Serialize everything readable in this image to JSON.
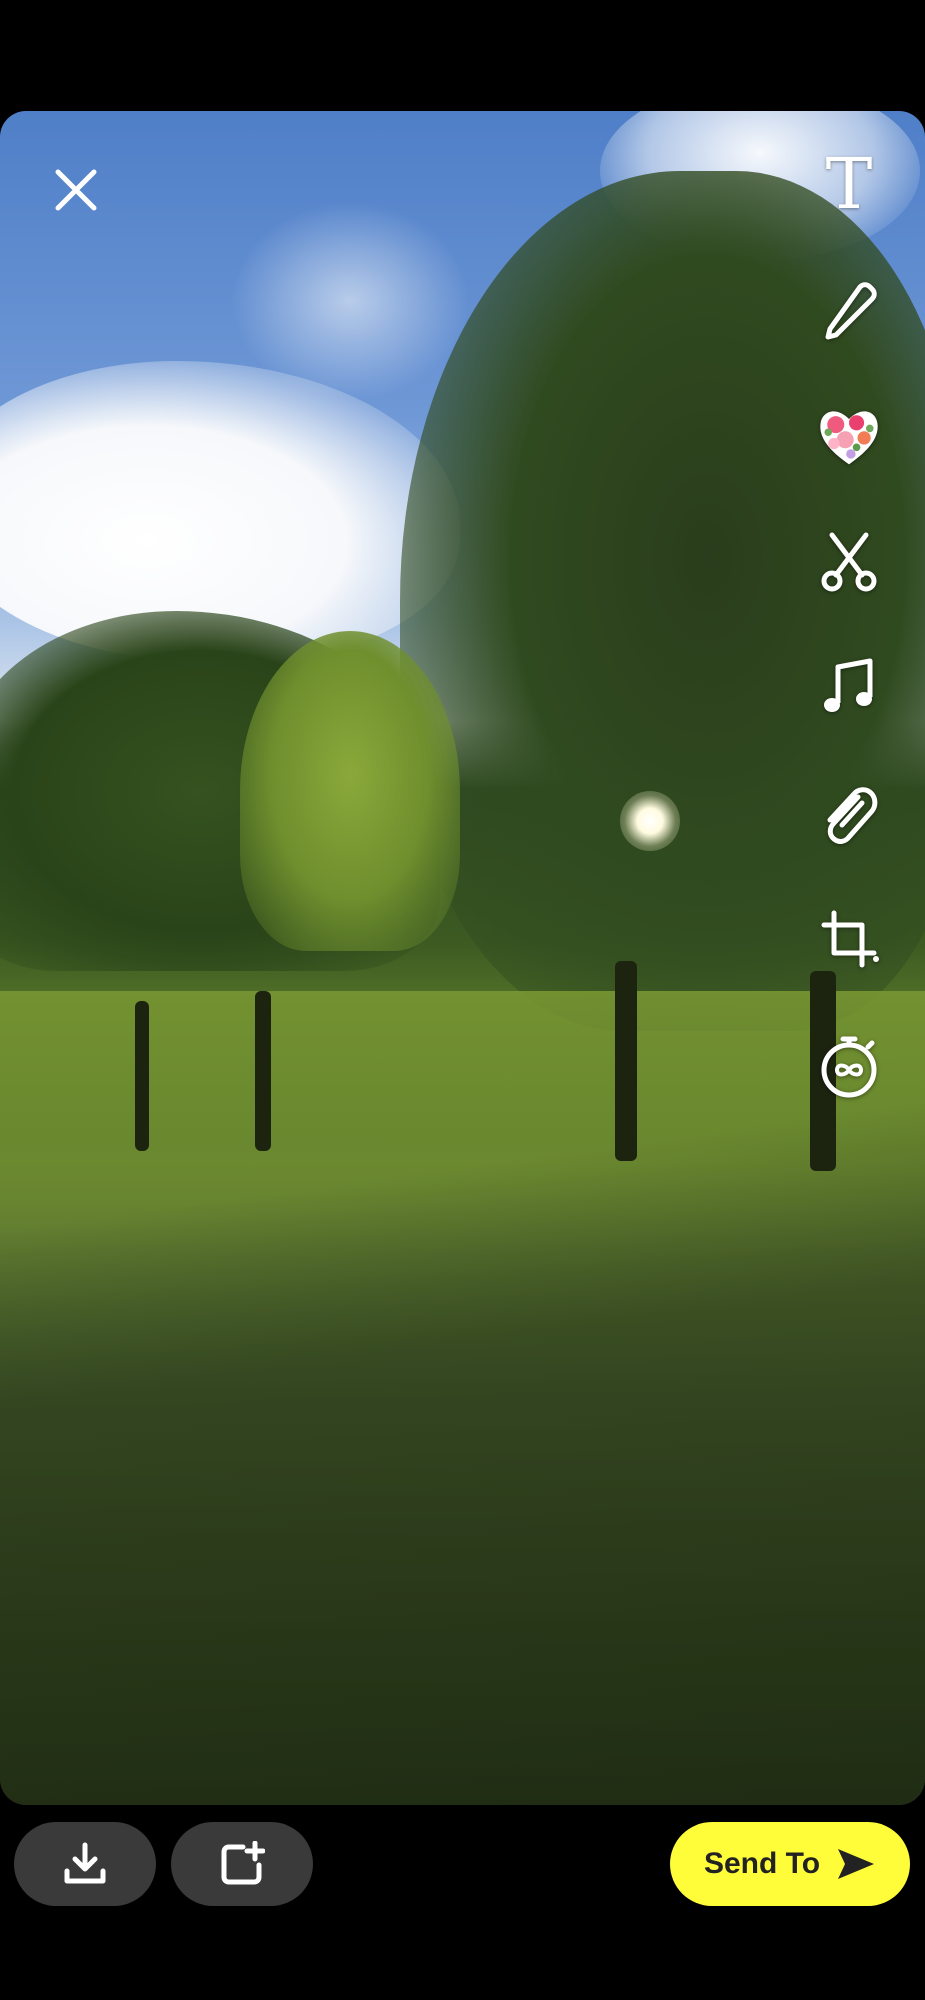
{
  "editor": {
    "close_icon": "close-x-icon",
    "tools": [
      {
        "name": "text-tool",
        "icon": "text-T-icon",
        "glyph": "T"
      },
      {
        "name": "draw-tool",
        "icon": "pencil-icon"
      },
      {
        "name": "sticker-tool",
        "icon": "flower-heart-sticker-icon"
      },
      {
        "name": "scissors-tool",
        "icon": "scissors-icon"
      },
      {
        "name": "music-tool",
        "icon": "music-note-icon"
      },
      {
        "name": "link-tool",
        "icon": "paperclip-icon"
      },
      {
        "name": "crop-tool",
        "icon": "crop-icon"
      },
      {
        "name": "timer-tool",
        "icon": "timer-infinity-icon"
      }
    ]
  },
  "bottom_bar": {
    "download_icon": "download-icon",
    "add_story_icon": "add-story-icon",
    "send_label": "Send To",
    "send_icon": "send-arrow-icon",
    "accent_color": "#fffc3a"
  }
}
